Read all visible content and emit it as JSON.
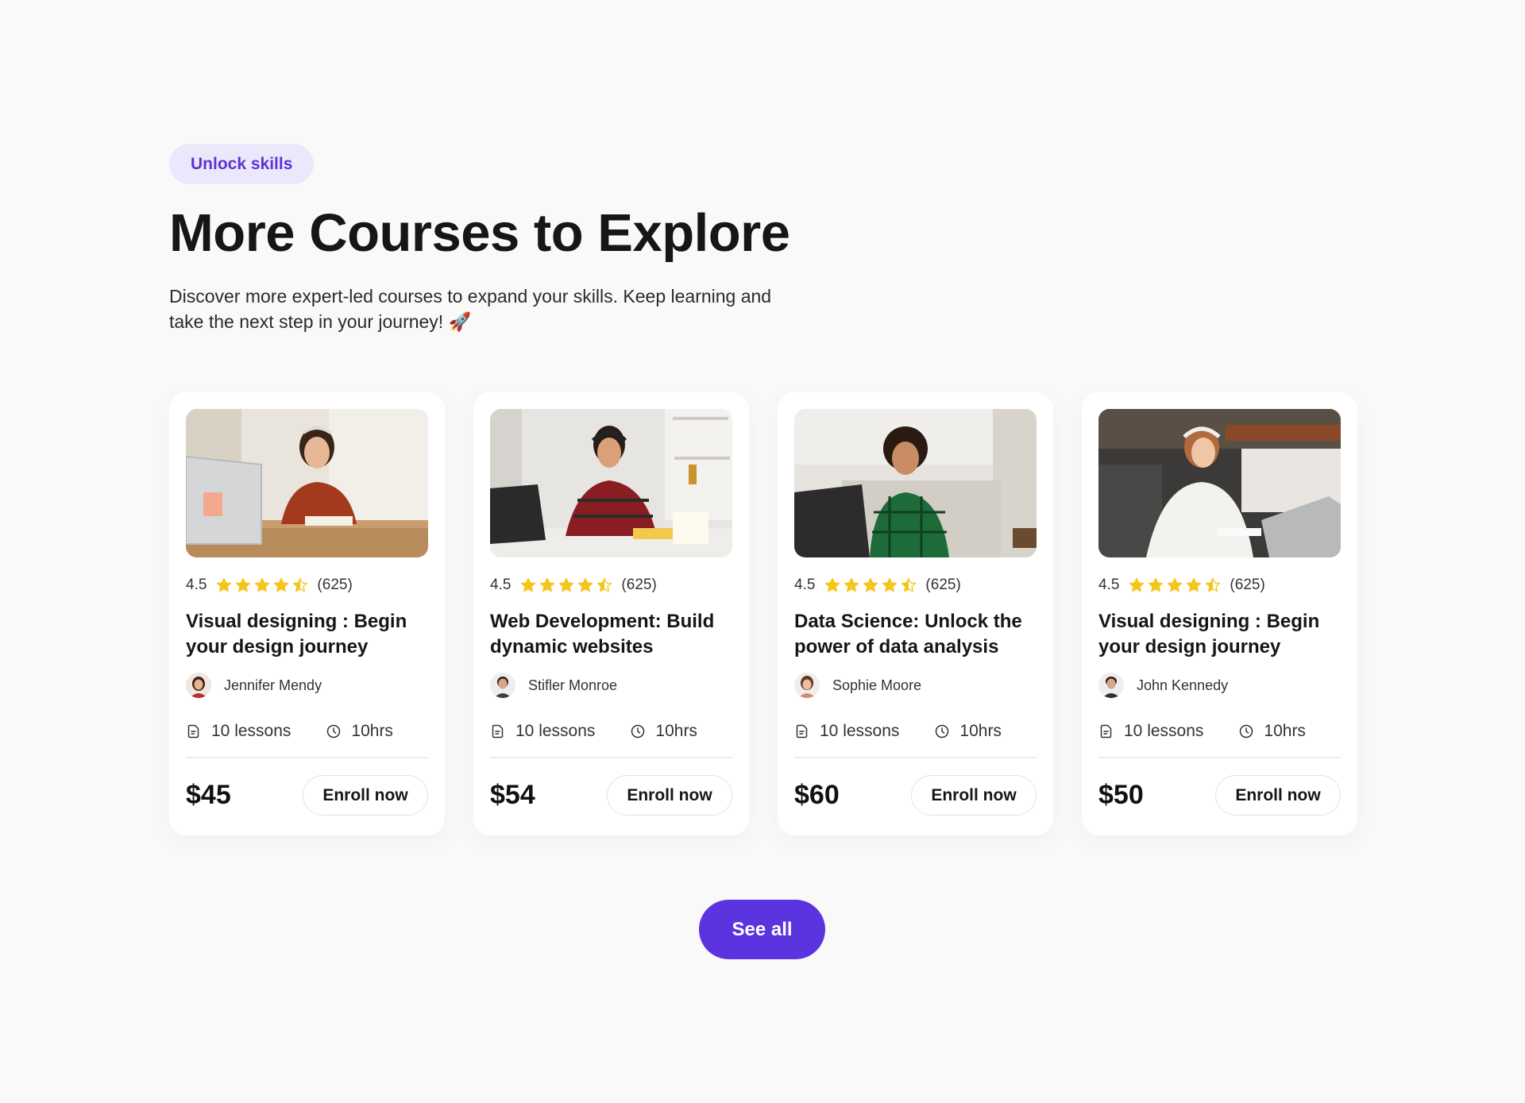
{
  "header": {
    "badge": "Unlock skills",
    "title": "More Courses to Explore",
    "description": "Discover more expert-led courses to expand your skills. Keep learning and take the next step in your journey! 🚀"
  },
  "colors": {
    "accent": "#5b34e0",
    "badge_bg": "#ece8fb",
    "star": "#f5c518"
  },
  "courses": [
    {
      "rating": "4.5",
      "stars": 4.5,
      "reviews": "(625)",
      "title": "Visual designing : Begin your design journey",
      "instructor": "Jennifer Mendy",
      "lessons": "10 lessons",
      "duration": "10hrs",
      "price": "$45",
      "enroll_label": "Enroll now",
      "image_icon": "student-laptop-photo"
    },
    {
      "rating": "4.5",
      "stars": 4.5,
      "reviews": "(625)",
      "title": "Web Development: Build dynamic websites",
      "instructor": "Stifler Monroe",
      "lessons": "10 lessons",
      "duration": "10hrs",
      "price": "$54",
      "enroll_label": "Enroll now",
      "image_icon": "student-laptop-photo"
    },
    {
      "rating": "4.5",
      "stars": 4.5,
      "reviews": "(625)",
      "title": "Data Science: Unlock the power of data analysis",
      "instructor": "Sophie Moore",
      "lessons": "10 lessons",
      "duration": "10hrs",
      "price": "$60",
      "enroll_label": "Enroll now",
      "image_icon": "student-laptop-photo"
    },
    {
      "rating": "4.5",
      "stars": 4.5,
      "reviews": "(625)",
      "title": "Visual designing : Begin your design journey",
      "instructor": "John Kennedy",
      "lessons": "10 lessons",
      "duration": "10hrs",
      "price": "$50",
      "enroll_label": "Enroll now",
      "image_icon": "student-laptop-photo"
    }
  ],
  "see_all_label": "See all"
}
